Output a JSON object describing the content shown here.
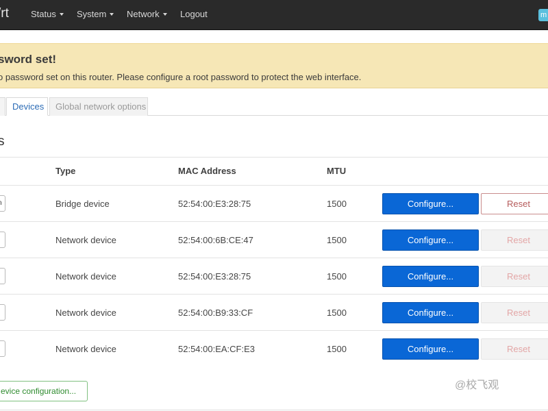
{
  "nav": {
    "brand": "/rt",
    "items": [
      {
        "label": "Status",
        "dropdown": true
      },
      {
        "label": "System",
        "dropdown": true
      },
      {
        "label": "Network",
        "dropdown": true
      },
      {
        "label": "Logout",
        "dropdown": false
      }
    ],
    "badge": "m"
  },
  "alert": {
    "title": "sword set!",
    "text": "o password set on this router. Please configure a root password to protect the web interface."
  },
  "tabs": [
    {
      "label": "",
      "state": "inactive"
    },
    {
      "label": "Devices",
      "state": "active"
    },
    {
      "label": "Global network options",
      "state": "inactive"
    }
  ],
  "section": {
    "title": "s"
  },
  "table": {
    "headers": {
      "type": "Type",
      "mac": "MAC Address",
      "mtu": "MTU"
    },
    "rows": [
      {
        "name": "n",
        "type": "Bridge device",
        "mac": "52:54:00:E3:28:75",
        "mtu": "1500",
        "configure": "Configure...",
        "reset": "Reset",
        "reset_enabled": true
      },
      {
        "name": "",
        "type": "Network device",
        "mac": "52:54:00:6B:CE:47",
        "mtu": "1500",
        "configure": "Configure...",
        "reset": "Reset",
        "reset_enabled": false
      },
      {
        "name": "",
        "type": "Network device",
        "mac": "52:54:00:E3:28:75",
        "mtu": "1500",
        "configure": "Configure...",
        "reset": "Reset",
        "reset_enabled": false
      },
      {
        "name": "",
        "type": "Network device",
        "mac": "52:54:00:B9:33:CF",
        "mtu": "1500",
        "configure": "Configure...",
        "reset": "Reset",
        "reset_enabled": false
      },
      {
        "name": "",
        "type": "Network device",
        "mac": "52:54:00:EA:CF:E3",
        "mtu": "1500",
        "configure": "Configure...",
        "reset": "Reset",
        "reset_enabled": false
      }
    ]
  },
  "add_button": "evice configuration...",
  "watermark": "@校飞观"
}
